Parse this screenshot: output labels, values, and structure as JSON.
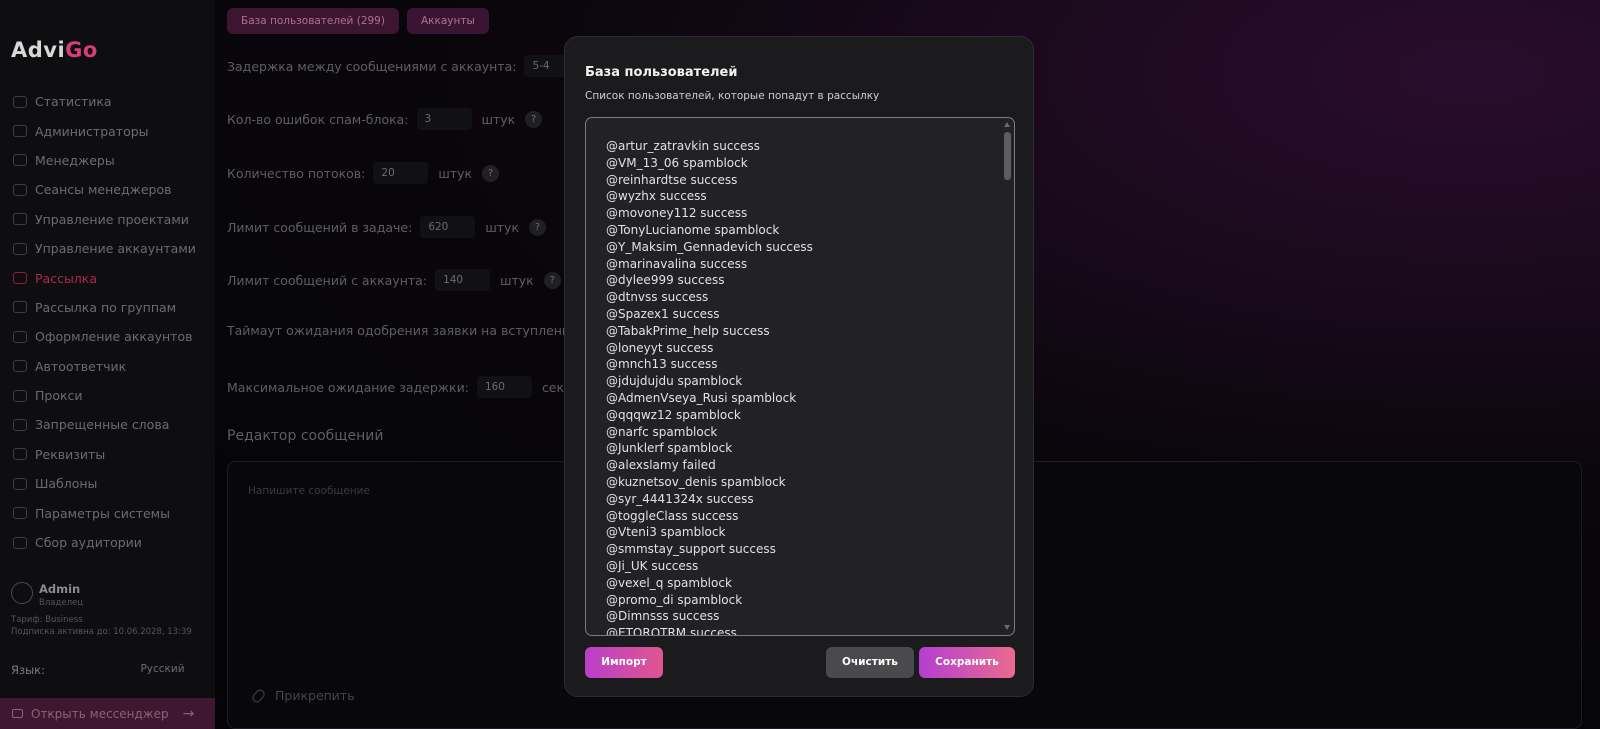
{
  "sidebar": {
    "logo_advi": "Advi",
    "logo_go": "Go",
    "nav": [
      {
        "label": "Статистика",
        "icon": "chart-icon"
      },
      {
        "label": "Администраторы",
        "icon": "admin-icon"
      },
      {
        "label": "Менеджеры",
        "icon": "managers-icon"
      },
      {
        "label": "Сеансы менеджеров",
        "icon": "sessions-icon"
      },
      {
        "label": "Управление проектами",
        "icon": "projects-icon"
      },
      {
        "label": "Управление аккаунтами",
        "icon": "accounts-icon"
      },
      {
        "label": "Рассылка",
        "icon": "mail-icon",
        "active": true
      },
      {
        "label": "Рассылка по группам",
        "icon": "groups-icon"
      },
      {
        "label": "Оформление аккаунтов",
        "icon": "design-icon"
      },
      {
        "label": "Автоответчик",
        "icon": "autoreply-icon"
      },
      {
        "label": "Прокси",
        "icon": "proxy-icon"
      },
      {
        "label": "Запрещенные слова",
        "icon": "forbidden-icon"
      },
      {
        "label": "Реквизиты",
        "icon": "requisites-icon"
      },
      {
        "label": "Шаблоны",
        "icon": "templates-icon"
      },
      {
        "label": "Параметры системы",
        "icon": "settings-icon"
      },
      {
        "label": "Сбор аудитории",
        "icon": "audience-icon"
      }
    ],
    "user": {
      "name": "Admin",
      "role": "Владелец",
      "plan": "Тариф: Business",
      "subscription": "Подписка активна до: 10.06.2028, 13:39"
    },
    "language_label": "Язык:",
    "language_value": "Русский",
    "messenger_button": "Открыть мессенджер"
  },
  "main": {
    "tabs": [
      "База пользователей (299)",
      "Аккаунты"
    ],
    "fields": [
      {
        "label": "Задержка между сообщениями с аккаунта:",
        "value": "5-4",
        "unit": "",
        "help": ""
      },
      {
        "label": "Кол-во ошибок спам-блока:",
        "value": "3",
        "unit": "штук",
        "help": "?"
      },
      {
        "label": "Количество потоков:",
        "value": "20",
        "unit": "штук",
        "help": "?"
      },
      {
        "label": "Лимит сообщений в задаче:",
        "value": "620",
        "unit": "штук",
        "help": "?"
      },
      {
        "label": "Лимит сообщений с аккаунта:",
        "value": "140",
        "unit": "штук",
        "help": "?"
      },
      {
        "label": "Таймаут ожидания одобрения заявки на вступление",
        "value": "",
        "unit": "",
        "help": ""
      },
      {
        "label": "Максимальное ожидание задержки:",
        "value": "160",
        "unit": "сек.",
        "help": ""
      }
    ],
    "editor_title": "Редактор сообщений",
    "editor_placeholder": "Напишите сообщение",
    "attach_label": "Прикрепить"
  },
  "modal": {
    "title": "База пользователей",
    "description": "Список пользователей, которые попадут в рассылку",
    "users": [
      "@artur_zatravkin success",
      "@VM_13_06 spamblock",
      "@reinhardtse success",
      "@wyzhx success",
      "@movoney112 success",
      "@TonyLucianome spamblock",
      "@Y_Maksim_Gennadevich success",
      "@marinavalina success",
      "@dylee999 success",
      "@dtnvss success",
      "@Spazex1 success",
      "@TabakPrime_help success",
      "@loneyyt success",
      "@mnch13 success",
      "@jdujdujdu spamblock",
      "@AdmenVseya_Rusi spamblock",
      "@qqqwz12 spamblock",
      "@narfc spamblock",
      "@Junklerf spamblock",
      "@alexslamy failed",
      "@kuznetsov_denis spamblock",
      "@syr_4441324x success",
      "@toggleClass success",
      "@Vteni3 spamblock",
      "@smmstay_support success",
      "@Ji_UK success",
      "@vexel_q spamblock",
      "@promo_di spamblock",
      "@Dimnsss success",
      "@ETOROTRM success"
    ],
    "import_button": "Импорт",
    "clear_button": "Очистить",
    "save_button": "Сохранить"
  }
}
